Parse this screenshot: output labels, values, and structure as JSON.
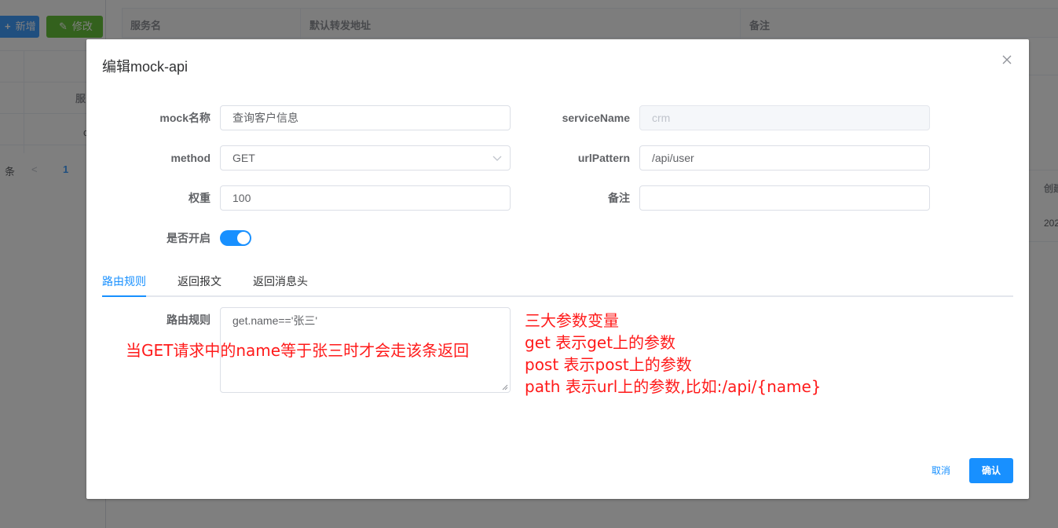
{
  "background": {
    "add_button": "新增",
    "edit_button": "修改",
    "left_table_header": "服",
    "left_table_cell": "c",
    "pager_suffix": "条",
    "pager_prev": "<",
    "pager_current": "1",
    "table_headers": [
      "服务名",
      "默认转发地址",
      "备注"
    ],
    "right_col_header": "创建",
    "right_col_cell": "202"
  },
  "dialog": {
    "title": "编辑mock-api",
    "close_icon": "close-icon",
    "form": {
      "mock_name_label": "mock名称",
      "mock_name_value": "查询客户信息",
      "service_name_label": "serviceName",
      "service_name_placeholder": "crm",
      "method_label": "method",
      "method_value": "GET",
      "url_pattern_label": "urlPattern",
      "url_pattern_value": "/api/user",
      "weight_label": "权重",
      "weight_value": "100",
      "remark_label": "备注",
      "remark_value": "",
      "enabled_label": "是否开启",
      "enabled": true
    },
    "tabs": [
      "路由规则",
      "返回报文",
      "返回消息头"
    ],
    "active_tab": 0,
    "route_rule_label": "路由规则",
    "route_rule_value": "get.name=='张三'",
    "cancel_label": "取消",
    "confirm_label": "确认"
  },
  "annotations": {
    "left": "当GET请求中的name等于张三时才会走该条返回",
    "right": [
      "三大参数变量",
      "get  表示get上的参数",
      "post 表示post上的参数",
      "path  表示url上的参数,比如:/api/{name}"
    ]
  },
  "colors": {
    "primary": "#1890ff",
    "success": "#67c23a",
    "annotation": "#ff1a1a",
    "overlay": "rgba(0,0,0,0.5)"
  }
}
